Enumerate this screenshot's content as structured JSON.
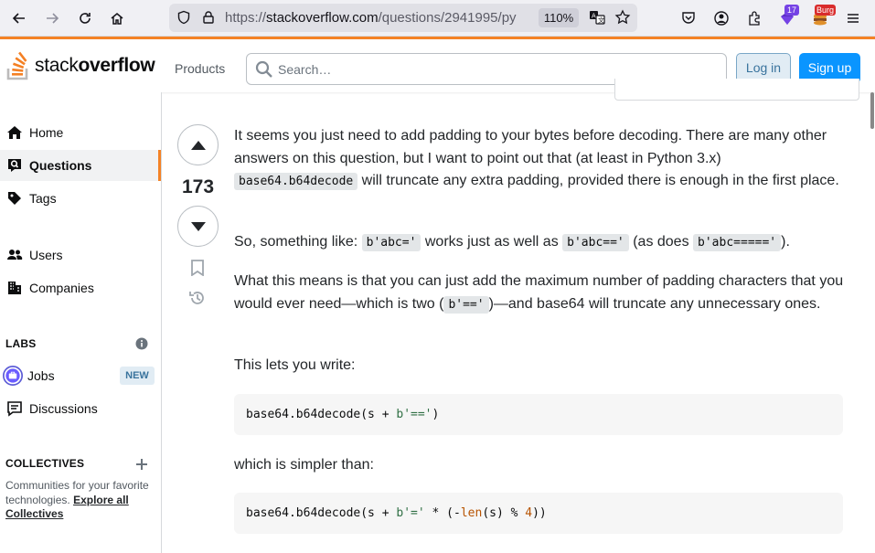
{
  "browser": {
    "url_prefix": "https://",
    "url_host": "stackoverflow.com",
    "url_path": "/questions/2941995/py",
    "zoom": "110%",
    "ext_badge_count": "17",
    "ext_badge_label": "Burg"
  },
  "header": {
    "logo_light": "stack",
    "logo_bold": "overflow",
    "products": "Products",
    "search_placeholder": "Search…",
    "login": "Log in",
    "signup": "Sign up"
  },
  "sidebar": {
    "home": "Home",
    "questions": "Questions",
    "tags": "Tags",
    "users": "Users",
    "companies": "Companies",
    "labs_title": "LABS",
    "jobs": "Jobs",
    "jobs_badge": "NEW",
    "discussions": "Discussions",
    "collectives_title": "COLLECTIVES",
    "collectives_text": "Communities for your favorite technologies.",
    "collectives_link": "Explore all Collectives"
  },
  "answer": {
    "votes": "173",
    "p1_a": "It seems you just need to add padding to your bytes before decoding. There are many other answers on this question, but I want to point out that (at least in Python 3.x) ",
    "p1_code": "base64.b64decode",
    "p1_b": " will truncate any extra padding, provided there is enough in the first place.",
    "p2_a": "So, something like: ",
    "p2_code1": "b'abc='",
    "p2_b": " works just as well as ",
    "p2_code2": "b'abc=='",
    "p2_c": " (as does ",
    "p2_code3": "b'abc====='",
    "p2_d": ").",
    "p3_a": "What this means is that you can just add the maximum number of padding characters that you would ever need—which is two (",
    "p3_code": "b'=='",
    "p3_b": ")—and base64 will truncate any unnecessary ones.",
    "p4": "This lets you write:",
    "code1_a": "base64.b64decode(s + ",
    "code1_str": "b'=='",
    "code1_b": ")",
    "p5": "which is simpler than:",
    "code2_a": "base64.b64decode(s + ",
    "code2_str": "b'='",
    "code2_b": " * (-",
    "code2_fn": "len",
    "code2_c": "(s) % ",
    "code2_num": "4",
    "code2_d": "))"
  }
}
